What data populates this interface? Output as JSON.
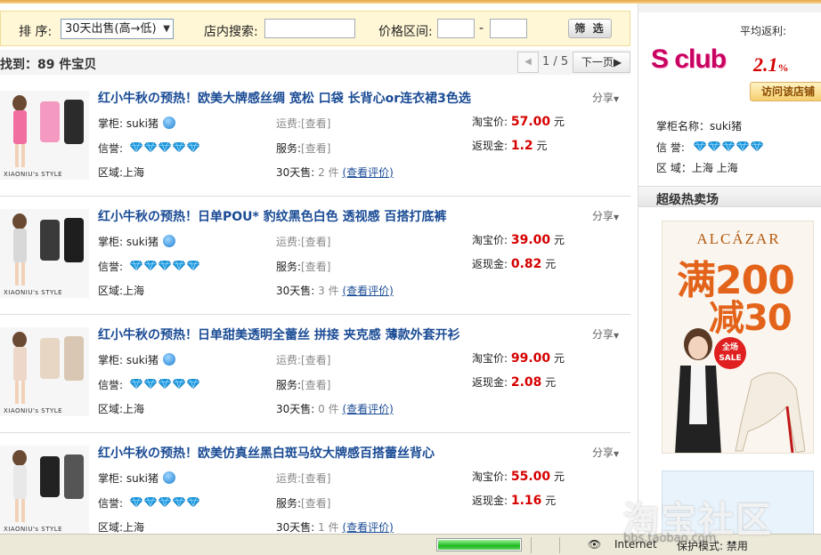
{
  "filter": {
    "sort_label": "排 序:",
    "sort_value": "30天出售(高→低)",
    "search_label": "店内搜索:",
    "price_label": "价格区间:",
    "price_dash": "-",
    "filter_button": "筛 选"
  },
  "results": {
    "count_text": "共找到：89 件宝贝",
    "page_indicator": "1 / 5",
    "prev_icon": "◀",
    "next_label": "下一页▶"
  },
  "labels": {
    "seller": "掌柜:",
    "credit": "信誉:",
    "region": "区域:",
    "shipping": "运费:",
    "service": "服务:",
    "sales30": "30天售:",
    "taobao_price": "淘宝价:",
    "cashback": "返现金:",
    "view": "[查看]",
    "view_reviews": "(查看评价)",
    "share": "分享",
    "currency": "元",
    "brand_tag": "XIAONIU's STYLE"
  },
  "items": [
    {
      "title": "红小牛秋の预热！欧美大牌感丝绸 宽松 口袋 长背心or连衣裙3色选",
      "seller": "suki猪",
      "region": "上海",
      "sales": "2 件",
      "price": "57.00",
      "cashback": "1.2"
    },
    {
      "title": "红小牛秋の预热！日单POU* 豹纹黑色白色 透视感 百搭打底裤",
      "seller": "suki猪",
      "region": "上海",
      "sales": "3 件",
      "price": "39.00",
      "cashback": "0.82"
    },
    {
      "title": "红小牛秋の预热！日单甜美透明全蕾丝 拼接 夹克感 薄款外套开衫",
      "seller": "suki猪",
      "region": "上海",
      "sales": "0 件",
      "price": "99.00",
      "cashback": "2.08"
    },
    {
      "title": "红小牛秋の预热！欧美仿真丝黑白斑马纹大牌感百搭蕾丝背心",
      "seller": "suki猪",
      "region": "上海",
      "sales": "1 件",
      "price": "55.00",
      "cashback": "1.16"
    }
  ],
  "sidebar": {
    "avg_cashback_label": "平均返利:",
    "logo_text": "S club",
    "rate": "2.1",
    "rate_unit": "%",
    "visit_button": "访问该店铺",
    "seller_name_row": "掌柜名称：suki猪",
    "credit_row": "信 誉:",
    "region_row": "区 域：上海 上海",
    "section_title": "超级热卖场"
  },
  "ad": {
    "brand": "ALCÁZAR",
    "line1": "满200",
    "line2": "减30",
    "badge": "全场 SALE"
  },
  "status": {
    "progress": 1.0,
    "zone_text": "Internet",
    "text": "保护模式: 禁用"
  },
  "watermark": {
    "main": "淘宝社区",
    "sub": "bbs.taobao.com"
  },
  "colors": {
    "title_link": "#1a4b95",
    "price": "#d60000",
    "diamond": "#1e9be0",
    "filter_bg": "#fff7d6"
  }
}
